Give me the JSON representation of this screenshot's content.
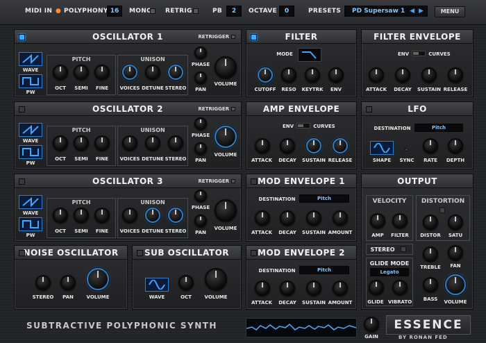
{
  "topbar": {
    "midi_in": "MIDI IN",
    "polyphony_label": "POLYPHONY",
    "polyphony_value": "16",
    "mono_label": "MONO",
    "retrig_label": "RETRIG",
    "pb_label": "PB",
    "pb_value": "2",
    "octave_label": "OCTAVE",
    "octave_value": "0",
    "presets_label": "PRESETS",
    "preset_name": "PD Supersaw 1",
    "menu_label": "MENU"
  },
  "osc1": {
    "title": "OSCILLATOR 1",
    "retrigger": "RETRIGGER",
    "wave": "WAVE",
    "pw": "PW",
    "pitch": "PITCH",
    "unison": "UNISON",
    "oct": "OCT",
    "semi": "SEMI",
    "fine": "FINE",
    "voices": "VOICES",
    "detune": "DETUNE",
    "stereo": "STEREO",
    "phase": "PHASE",
    "pan": "PAN",
    "volume": "VOLUME"
  },
  "osc2": {
    "title": "OSCILLATOR 2",
    "retrigger": "RETRIGGER",
    "wave": "WAVE",
    "pw": "PW",
    "pitch": "PITCH",
    "unison": "UNISON",
    "oct": "OCT",
    "semi": "SEMI",
    "fine": "FINE",
    "voices": "VOICES",
    "detune": "DETUNE",
    "stereo": "STEREO",
    "phase": "PHASE",
    "pan": "PAN",
    "volume": "VOLUME"
  },
  "osc3": {
    "title": "OSCILLATOR 3",
    "retrigger": "RETRIGGER",
    "wave": "WAVE",
    "pw": "PW",
    "pitch": "PITCH",
    "unison": "UNISON",
    "oct": "OCT",
    "semi": "SEMI",
    "fine": "FINE",
    "voices": "VOICES",
    "detune": "DETUNE",
    "stereo": "STEREO",
    "phase": "PHASE",
    "pan": "PAN",
    "volume": "VOLUME"
  },
  "noise": {
    "title": "NOISE OSCILLATOR",
    "stereo": "STEREO",
    "pan": "PAN",
    "volume": "VOLUME"
  },
  "sub": {
    "title": "SUB OSCILLATOR",
    "wave": "WAVE",
    "oct": "OCT",
    "volume": "VOLUME"
  },
  "filter": {
    "title": "FILTER",
    "mode": "MODE",
    "cutoff": "CUTOFF",
    "reso": "RESO",
    "keytrk": "KEYTRK",
    "env": "ENV"
  },
  "filter_env": {
    "title": "FILTER ENVELOPE",
    "env": "ENV",
    "curves": "CURVES",
    "attack": "ATTACK",
    "decay": "DECAY",
    "sustain": "SUSTAIN",
    "release": "RELEASE"
  },
  "amp_env": {
    "title": "AMP ENVELOPE",
    "env": "ENV",
    "curves": "CURVES",
    "attack": "ATTACK",
    "decay": "DECAY",
    "sustain": "SUSTAIN",
    "release": "RELEASE"
  },
  "lfo": {
    "title": "LFO",
    "destination": "DESTINATION",
    "dest_value": "Pitch",
    "shape": "SHAPE",
    "sync": "SYNC",
    "rate": "RATE",
    "depth": "DEPTH"
  },
  "mod_env1": {
    "title": "MOD ENVELOPE 1",
    "destination": "DESTINATION",
    "dest_value": "Pitch",
    "attack": "ATTACK",
    "decay": "DECAY",
    "sustain": "SUSTAIN",
    "amount": "AMOUNT"
  },
  "mod_env2": {
    "title": "MOD ENVELOPE 2",
    "destination": "DESTINATION",
    "dest_value": "Pitch",
    "attack": "ATTACK",
    "decay": "DECAY",
    "sustain": "SUSTAIN",
    "amount": "AMOUNT"
  },
  "output": {
    "title": "OUTPUT",
    "velocity": "VELOCITY",
    "amp": "AMP",
    "filter": "FILTER",
    "distortion": "DISTORTION",
    "distor": "DISTOR",
    "satu": "SATU",
    "stereo": "STEREO",
    "glide_mode": "GLIDE MODE",
    "glide_value": "Legato",
    "glide": "GLIDE",
    "vibrato": "VIBRATO",
    "treble": "TREBLE",
    "bass": "BASS",
    "fan": "FAN",
    "volume": "VOLUME"
  },
  "footer": {
    "subtitle": "SUBTRACTIVE POLYPHONIC SYNTH",
    "gain": "GAIN",
    "logo": "ESSENCE",
    "by": "BY RONAN FED"
  },
  "colors": {
    "accent": "#3ca8ff",
    "display_text": "#7fc8ff"
  }
}
